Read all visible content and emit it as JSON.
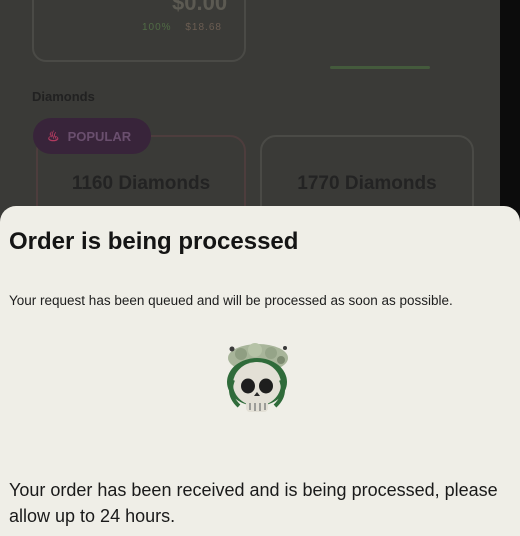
{
  "background": {
    "price": "$0.00",
    "price_percent": "100%",
    "price_old": "$18.68",
    "section_label": "Diamonds",
    "popular_badge": "POPULAR",
    "packages": [
      "1160 Diamonds",
      "1770 Diamonds"
    ]
  },
  "sheet": {
    "title": "Order is being processed",
    "description": "Your request has been queued and will be processed as soon as possible.",
    "info": "Your order has been received and is being processed, please allow up to 24 hours.",
    "illustration_icon": "skull-sticker-icon"
  },
  "colors": {
    "sheet_bg": "#efeee7",
    "dim_bg": "#3a3a37",
    "badge": "#38243a"
  }
}
